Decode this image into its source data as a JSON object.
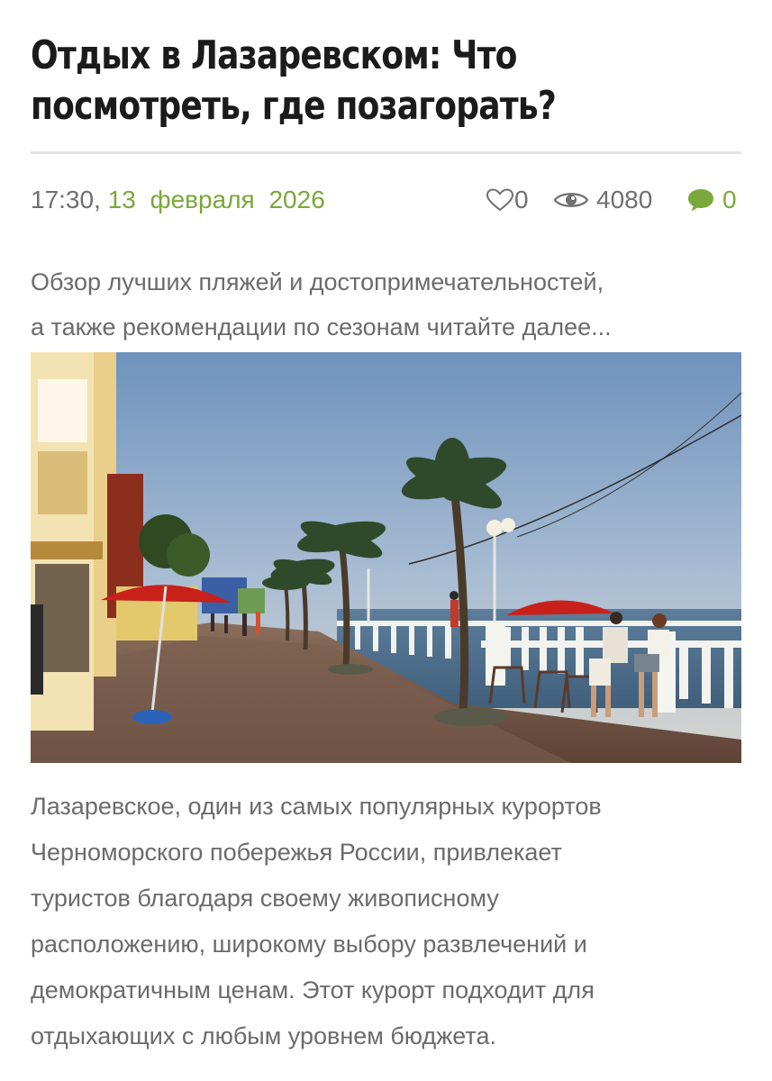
{
  "article": {
    "title_lines": [
      "Отдых в Лазаревском: Что",
      "посмотреть, где позагорать?"
    ],
    "meta": {
      "time": "17:30,",
      "date": "13 февраля 2026",
      "likes": "0",
      "views": "4080",
      "comments": "0"
    },
    "lead_lines": [
      "Обзор лучших пляжей и достопримечательностей,",
      "а также рекомендации по сезонам читайте далее..."
    ],
    "body_lines": [
      "Лазаревское, один из самых популярных курортов",
      "Черноморского побережья России, привлекает",
      "туристов благодаря своему живописному",
      "расположению, широкому выбору развлечений и",
      "демократичным ценам. Этот курорт подходит для",
      "отдыхающих с любым уровнем бюджета."
    ]
  },
  "icons": {
    "likes": "heart-icon",
    "views": "eye-icon",
    "comments": "comment-bubble-icon"
  },
  "colors": {
    "accent_green": "#7ba83a",
    "text_gray": "#6b6b6b",
    "title": "#1b1b1b"
  }
}
